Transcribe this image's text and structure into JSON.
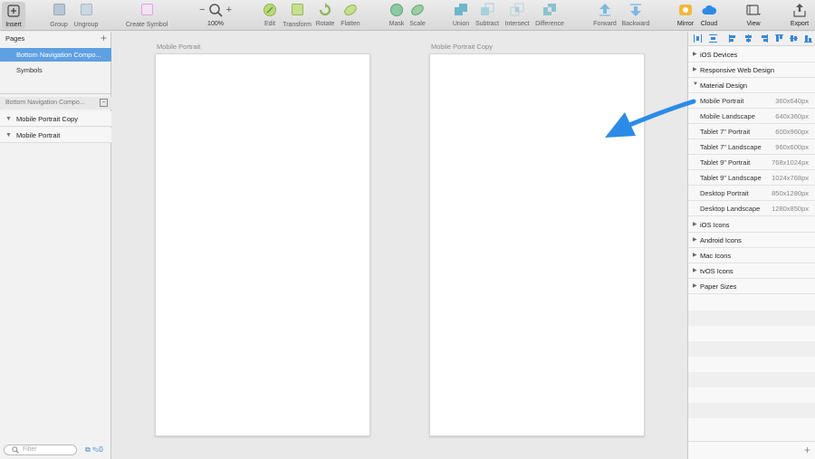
{
  "toolbar": {
    "insert": "Insert",
    "group": "Group",
    "ungroup": "Ungroup",
    "create_symbol": "Create Symbol",
    "zoom_minus": "−",
    "zoom_value": "100%",
    "zoom_plus": "+",
    "edit": "Edit",
    "transform": "Transform",
    "rotate": "Rotate",
    "flatten": "Flatten",
    "mask": "Mask",
    "scale": "Scale",
    "union": "Union",
    "subtract": "Subtract",
    "intersect": "Intersect",
    "difference": "Difference",
    "forward": "Forward",
    "backward": "Backward",
    "mirror": "Mirror",
    "cloud": "Cloud",
    "view": "View",
    "export": "Export"
  },
  "pages": {
    "title": "Pages",
    "add": "+",
    "items": [
      {
        "label": "Bottom Navigation Compo..."
      },
      {
        "label": "Symbols"
      }
    ]
  },
  "layers": {
    "header": "Bottom Navigation Compo...",
    "items": [
      {
        "label": "Mobile Portrait Copy"
      },
      {
        "label": "Mobile Portrait"
      }
    ]
  },
  "filter": {
    "placeholder": "Filter",
    "count": "0"
  },
  "canvas": {
    "artboards": [
      {
        "label": "Mobile Portrait"
      },
      {
        "label": "Mobile Portrait Copy"
      }
    ]
  },
  "presets": {
    "groups": [
      {
        "label": "iOS Devices"
      },
      {
        "label": "Responsive Web Design"
      },
      {
        "label": "Material Design"
      },
      {
        "label": "iOS Icons"
      },
      {
        "label": "Android Icons"
      },
      {
        "label": "Mac Icons"
      },
      {
        "label": "tvOS Icons"
      },
      {
        "label": "Paper Sizes"
      }
    ],
    "material": [
      {
        "name": "Mobile Portrait",
        "size": "360x640px"
      },
      {
        "name": "Mobile Landscape",
        "size": "640x360px"
      },
      {
        "name": "Tablet 7\" Portrait",
        "size": "600x960px"
      },
      {
        "name": "Tablet 7\" Landscape",
        "size": "960x600px"
      },
      {
        "name": "Tablet 9\" Portrait",
        "size": "768x1024px"
      },
      {
        "name": "Tablet 9\" Landscape",
        "size": "1024x768px"
      },
      {
        "name": "Desktop Portrait",
        "size": "850x1280px"
      },
      {
        "name": "Desktop Landscape",
        "size": "1280x850px"
      }
    ],
    "add": "+"
  },
  "colors": {
    "selection": "#5ea0e2",
    "annotation_arrow": "#2b8be6"
  }
}
